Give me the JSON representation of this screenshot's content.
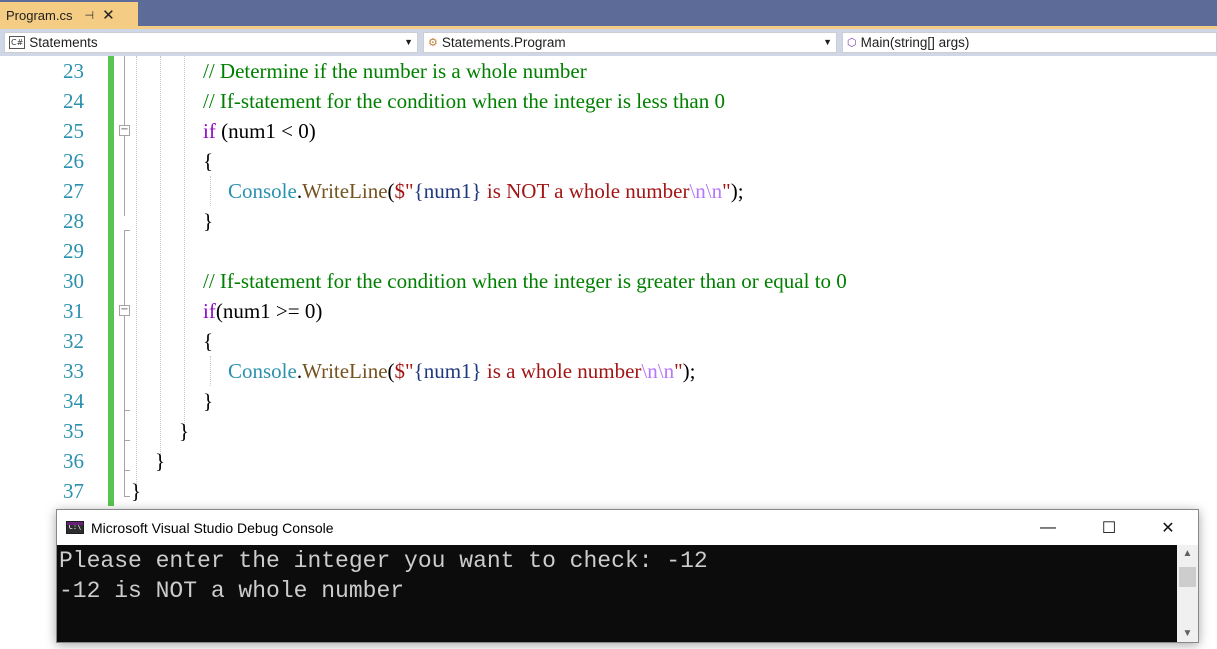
{
  "tab": {
    "title": "Program.cs",
    "pin": "⊣",
    "close": "✕"
  },
  "navbar": {
    "project": "Statements",
    "project_badge": "C#",
    "class": "Statements.Program",
    "member": "Main(string[] args)"
  },
  "editor": {
    "line_numbers": [
      "23",
      "24",
      "25",
      "26",
      "27",
      "28",
      "29",
      "30",
      "31",
      "32",
      "33",
      "34",
      "35",
      "36",
      "37"
    ],
    "lines": {
      "l23": "// Determine if the number is a whole number",
      "l24": "// If-statement for the condition when the integer is less than 0",
      "l25_kw": "if",
      "l25_rest": " (num1 < 0)",
      "l26": "{",
      "l27_type": "Console",
      "l27_dot": ".",
      "l27_method": "WriteLine",
      "l27_open": "(",
      "l27_str1": "$\"",
      "l27_interp": "{num1}",
      "l27_str2": " is NOT a whole number",
      "l27_esc": "\\n\\n",
      "l27_str3": "\"",
      "l27_close": ");",
      "l28": "}",
      "l30": "// If-statement for the condition when the integer is greater than or equal to 0",
      "l31_kw": "if",
      "l31_rest": "(num1 >= 0)",
      "l32": "{",
      "l33_type": "Console",
      "l33_dot": ".",
      "l33_method": "WriteLine",
      "l33_open": "(",
      "l33_str1": "$\"",
      "l33_interp": "{num1}",
      "l33_str2": " is a whole number",
      "l33_esc": "\\n\\n",
      "l33_str3": "\"",
      "l33_close": ");",
      "l34": "}",
      "l35": "}",
      "l36": "}",
      "l37": "}"
    }
  },
  "console": {
    "title": "Microsoft Visual Studio Debug Console",
    "icon_text": "C:\\",
    "minimize": "—",
    "maximize": "☐",
    "close": "✕",
    "output": [
      "Please enter the integer you want to check: -12",
      "-12 is NOT a whole number"
    ]
  }
}
